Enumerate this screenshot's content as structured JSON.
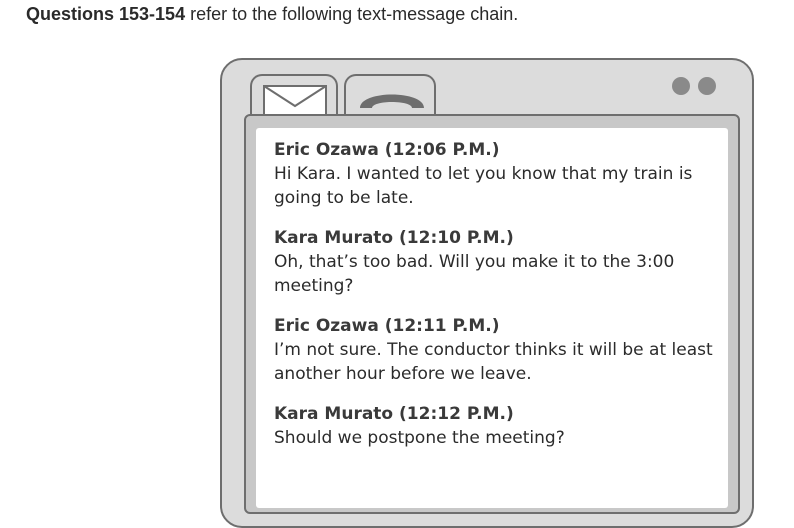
{
  "intro": {
    "question_numbers": "Questions 153-154",
    "text": " refer to the following text-message chain."
  },
  "window": {
    "tabs": [
      {
        "icon": "envelope-icon"
      },
      {
        "icon": "phone-icon"
      }
    ],
    "indicator_color": "#8a8a8a"
  },
  "messages": [
    {
      "sender": "Eric Ozawa (12:06 P.M.)",
      "text": "Hi Kara. I wanted to let you know that my train is going to be late."
    },
    {
      "sender": "Kara Murato (12:10 P.M.)",
      "text": "Oh, that’s too bad. Will you make it to the 3:00 meeting?"
    },
    {
      "sender": "Eric Ozawa (12:11 P.M.)",
      "text": "I’m not sure. The conductor thinks it will be at least another hour before we leave."
    },
    {
      "sender": "Kara Murato (12:12 P.M.)",
      "text": "Should we postpone the meeting?"
    }
  ]
}
